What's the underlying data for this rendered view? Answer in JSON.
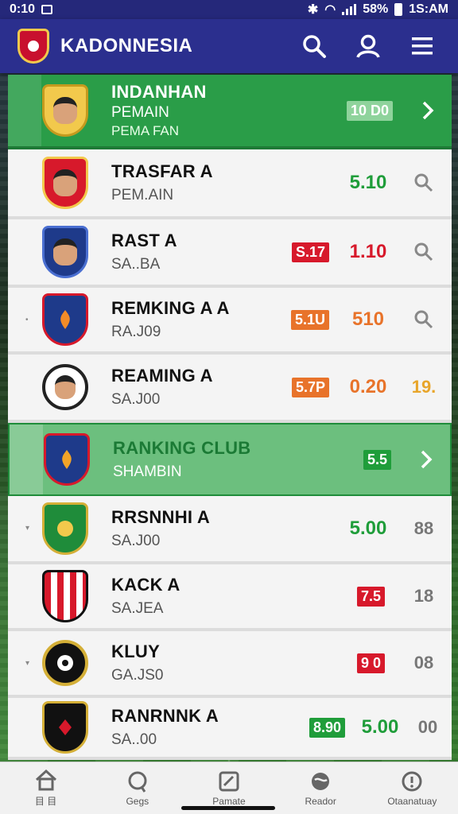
{
  "status_bar": {
    "time_left": "0:10",
    "battery": "58%",
    "clock": "1S:AM"
  },
  "header": {
    "title": "KADONNESIA"
  },
  "rows": [
    {
      "name": "INDANHAN",
      "sub": "PEMAIN",
      "sub2": "PEMA FAN",
      "tag": "10 D0",
      "tag_color": "#2a9d48",
      "value": "",
      "value_color": "#ffffff",
      "end": "chevron"
    },
    {
      "name": "TRASFAR A",
      "sub": "PEM.AIN",
      "tag": "",
      "value": "5.10",
      "value_color": "#1f9d3a",
      "end": "search"
    },
    {
      "name": "RAST A",
      "sub": "SA..BA",
      "tag": "S.17",
      "tag_color": "#d7192b",
      "value": "1.10",
      "value_color": "#d7192b",
      "end": "search"
    },
    {
      "name": "REMKING A A",
      "sub": "RA.J09",
      "tag": "5.1U",
      "tag_color": "#e8732a",
      "value": "510",
      "value_color": "#e8732a",
      "end": "search"
    },
    {
      "name": "REAMING A",
      "sub": "SA.J00",
      "tag": "5.7P",
      "tag_color": "#e8732a",
      "value": "0.20",
      "value_color": "#e8732a",
      "end_text": "19.",
      "end_color": "#e8a52a"
    },
    {
      "name": "RANKING CLUB",
      "sub": "SHAMBIN",
      "tag": "5.5",
      "tag_color": "#1f9d3a",
      "value": "",
      "value_color": "#ffffff",
      "end": "chevron"
    },
    {
      "name": "RRSNNHI A",
      "sub": "SA.J00",
      "tag": "",
      "value": "5.00",
      "value_color": "#1f9d3a",
      "end_text": "88",
      "end_color": "#777777"
    },
    {
      "name": "KACK A",
      "sub": "SA.JEA",
      "tag": "7.5",
      "tag_color": "#d7192b",
      "value": "",
      "value_color": "#d7192b",
      "end_text": "18",
      "end_color": "#777777"
    },
    {
      "name": "KLUY",
      "sub": "GA.JS0",
      "tag": "9 0",
      "tag_color": "#d7192b",
      "value": "",
      "value_color": "#d7192b",
      "end_text": "08",
      "end_color": "#777777"
    },
    {
      "name": "RANRNNK A",
      "sub": "SA..00",
      "tag": "8.90",
      "tag_color": "#1f9d3a",
      "value": "5.00",
      "value_color": "#1f9d3a",
      "end_text": "00",
      "end_color": "#777777"
    }
  ],
  "nav": [
    {
      "label": "目 目",
      "icon": "home-icon"
    },
    {
      "label": "Gegs",
      "icon": "chat-icon"
    },
    {
      "label": "Pamate",
      "icon": "edit-icon"
    },
    {
      "label": "Reador",
      "icon": "ball-icon"
    },
    {
      "label": "Otaanatuay",
      "icon": "info-icon"
    }
  ]
}
